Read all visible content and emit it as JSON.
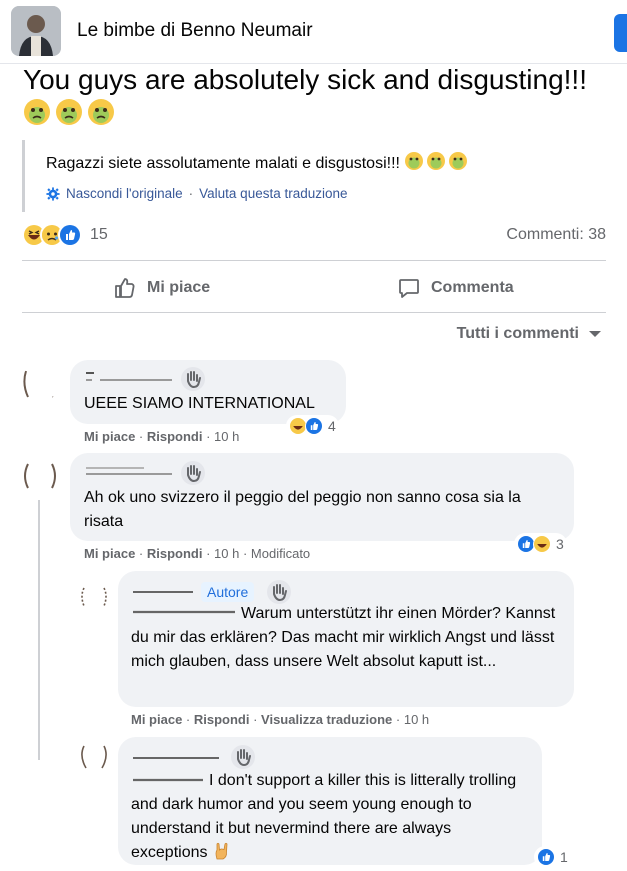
{
  "header": {
    "title": "Le bimbe di Benno Neumair"
  },
  "post": {
    "text": "You guys are absolutely sick and disgusting!!!",
    "translated_text": "Ragazzi siete assolutamente malati e disgustosi!!!",
    "hide_original": "Nascondi l'originale",
    "rate_translation": "Valuta questa traduzione",
    "reactions_count": "15",
    "comments_count": "Commenti: 38"
  },
  "actions": {
    "like": "Mi piace",
    "comment": "Commenta"
  },
  "filter": {
    "label": "Tutti i commenti"
  },
  "comments": [
    {
      "text": "UEEE SIAMO INTERNATIONAL",
      "like": "Mi piace",
      "reply": "Rispondi",
      "time": "10 h",
      "reactions_count": "4"
    },
    {
      "text": "Ah ok uno svizzero il peggio del peggio non sanno cosa sia la risata",
      "like": "Mi piace",
      "reply": "Rispondi",
      "time": "10 h",
      "edited": "Modificato",
      "reactions_count": "3"
    },
    {
      "badge": "Autore",
      "text": "Warum unterstützt ihr einen Mörder? Kannst du mir das erklären? Das macht mir wirklich Angst und lässt mich glauben, dass unsere Welt absolut kaputt ist...",
      "like": "Mi piace",
      "reply": "Rispondi",
      "see_translation": "Visualizza traduzione",
      "time": "10 h"
    },
    {
      "text": "I don't support a killer this is litterally trolling and dark humor and you seem young enough to understand it but nevermind there are always exceptions",
      "reactions_count": "1"
    }
  ],
  "colors": {
    "link": "#385898",
    "secondary_text": "#65676b",
    "bubble": "#f0f2f5",
    "facebook_blue": "#1b74e4"
  }
}
